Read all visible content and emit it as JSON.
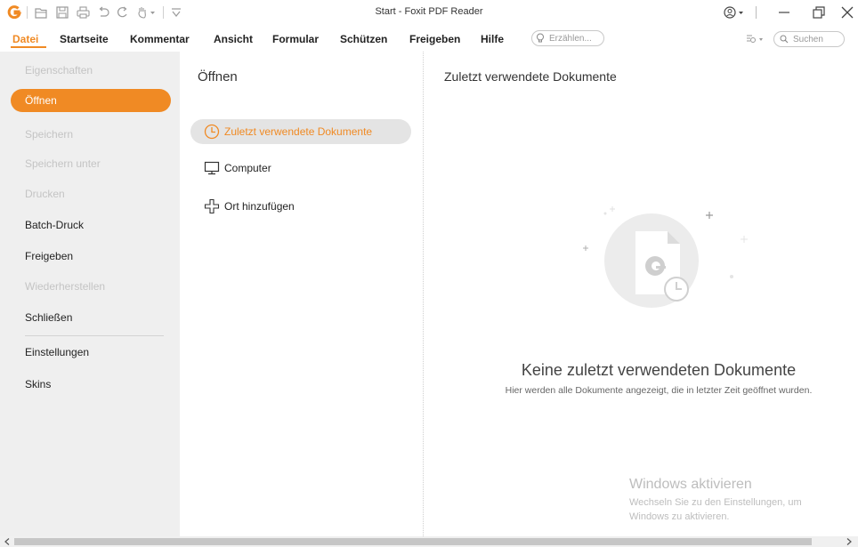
{
  "window": {
    "title": "Start - Foxit PDF Reader"
  },
  "colors": {
    "accent": "#f08a24",
    "left_panel_bg": "#efefef",
    "disabled_text": "#c4c4c4"
  },
  "quick_access": {
    "icons": [
      "foxit-logo-icon",
      "open-folder-icon",
      "save-icon",
      "print-icon",
      "undo-icon",
      "redo-icon",
      "hand-tool-icon",
      "customize-toolbar-icon"
    ]
  },
  "menu": {
    "tabs": [
      {
        "label": "Datei",
        "active": true
      },
      {
        "label": "Startseite"
      },
      {
        "label": "Kommentar"
      },
      {
        "label": "Ansicht"
      },
      {
        "label": "Formular"
      },
      {
        "label": "Schützen"
      },
      {
        "label": "Freigeben"
      },
      {
        "label": "Hilfe"
      }
    ],
    "tell_me_placeholder": "Erzählen...",
    "search_placeholder": "Suchen"
  },
  "backstage": {
    "items": [
      {
        "label": "Eigenschaften",
        "state": "disabled"
      },
      {
        "label": "Öffnen",
        "state": "selected"
      },
      {
        "label": "Speichern",
        "state": "disabled"
      },
      {
        "label": "Speichern unter",
        "state": "disabled"
      },
      {
        "label": "Drucken",
        "state": "disabled"
      },
      {
        "label": "Batch-Druck",
        "state": "enabled"
      },
      {
        "label": "Freigeben",
        "state": "enabled"
      },
      {
        "label": "Wiederherstellen",
        "state": "disabled"
      },
      {
        "label": "Schließen",
        "state": "enabled"
      },
      {
        "label": "Einstellungen",
        "state": "enabled"
      },
      {
        "label": "Skins",
        "state": "enabled"
      }
    ]
  },
  "open_pane": {
    "title": "Öffnen",
    "locations": [
      {
        "label": "Zuletzt verwendete Dokumente",
        "icon": "clock-icon",
        "selected": true
      },
      {
        "label": "Computer",
        "icon": "monitor-icon"
      },
      {
        "label": "Ort hinzufügen",
        "icon": "plus-icon"
      }
    ]
  },
  "recent_pane": {
    "title": "Zuletzt verwendete Dokumente",
    "empty_title": "Keine zuletzt verwendeten Dokumente",
    "empty_description": "Hier werden alle Dokumente angezeigt, die in letzter Zeit geöffnet wurden."
  },
  "watermark": {
    "title": "Windows aktivieren",
    "line1": "Wechseln Sie zu den Einstellungen, um",
    "line2": "Windows zu aktivieren."
  }
}
